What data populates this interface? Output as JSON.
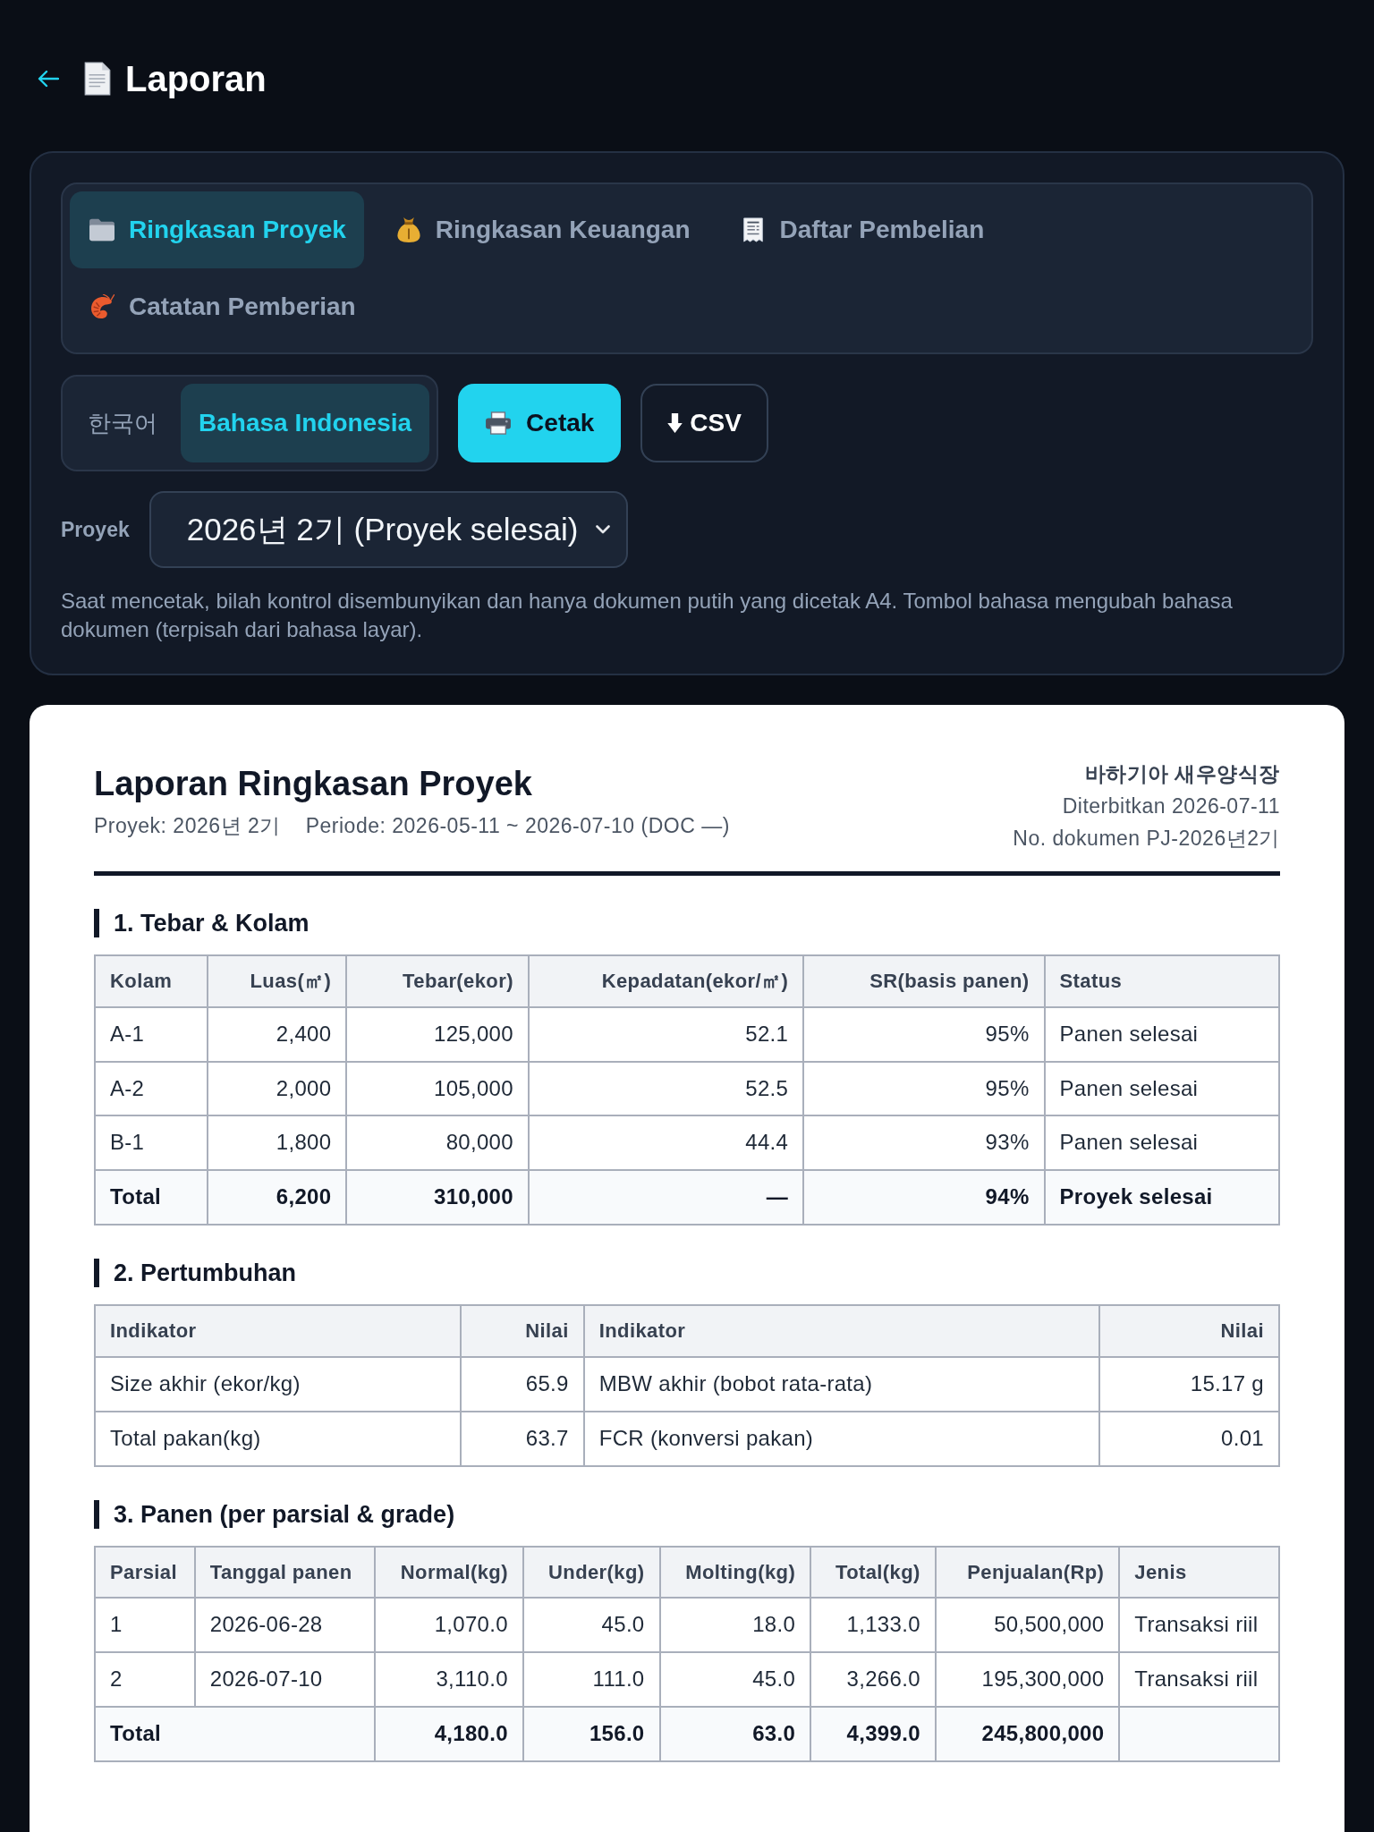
{
  "header": {
    "title": "Laporan"
  },
  "report_tabs": [
    {
      "label": "Ringkasan Proyek",
      "selected": true
    },
    {
      "label": "Ringkasan Keuangan",
      "selected": false
    },
    {
      "label": "Daftar Pembelian",
      "selected": false
    },
    {
      "label": "Catatan Pemberian",
      "selected": false
    }
  ],
  "language_toggle": [
    {
      "label": "한국어",
      "selected": false
    },
    {
      "label": "Bahasa Indonesia",
      "selected": true
    }
  ],
  "actions": [
    {
      "label": "Cetak",
      "kind": "print"
    },
    {
      "label": "CSV",
      "kind": "download"
    }
  ],
  "project_select": {
    "label": "Proyek",
    "value": "2026년 2기 (Proyek selesai)"
  },
  "print_note": "Saat mencetak, bilah kontrol disembunyikan dan hanya dokumen putih yang dicetak A4. Tombol bahasa mengubah bahasa dokumen (terpisah dari bahasa layar).",
  "document": {
    "title": "Laporan Ringkasan Proyek",
    "meta": [
      "Proyek: 2026년 2기",
      "Periode: 2026-05-11 ~ 2026-07-10 (DOC —)"
    ],
    "company": "바하기아 새우양식장",
    "issued": "Diterbitkan 2026-07-11",
    "doc_number": "No. dokumen PJ-2026년2기",
    "sections": [
      {
        "heading": "1. Tebar & Kolam",
        "columns": [
          {
            "label": "Kolam",
            "kind": "text"
          },
          {
            "label": "Luas(㎡)",
            "kind": "number"
          },
          {
            "label": "Tebar(ekor)",
            "kind": "number"
          },
          {
            "label": "Kepadatan(ekor/㎡)",
            "kind": "number"
          },
          {
            "label": "SR(basis panen)",
            "kind": "number"
          },
          {
            "label": "Status",
            "kind": "text"
          }
        ],
        "rows": [
          {
            "kind": "data",
            "cells": [
              "A-1",
              "2,400",
              "125,000",
              "52.1",
              "95%",
              "Panen selesai"
            ]
          },
          {
            "kind": "data",
            "cells": [
              "A-2",
              "2,000",
              "105,000",
              "52.5",
              "95%",
              "Panen selesai"
            ]
          },
          {
            "kind": "data",
            "cells": [
              "B-1",
              "1,800",
              "80,000",
              "44.4",
              "93%",
              "Panen selesai"
            ]
          },
          {
            "kind": "total",
            "cells": [
              "Total",
              "6,200",
              "310,000",
              "—",
              "94%",
              "Proyek selesai"
            ]
          }
        ]
      },
      {
        "heading": "2. Pertumbuhan",
        "columns": [
          {
            "label": "Indikator",
            "kind": "text"
          },
          {
            "label": "Nilai",
            "kind": "number"
          },
          {
            "label": "Indikator",
            "kind": "text"
          },
          {
            "label": "Nilai",
            "kind": "number"
          }
        ],
        "rows": [
          {
            "kind": "data",
            "cells": [
              "Size akhir (ekor/kg)",
              "65.9",
              "MBW akhir (bobot rata-rata)",
              "15.17 g"
            ]
          },
          {
            "kind": "data",
            "cells": [
              "Total pakan(kg)",
              "63.7",
              "FCR (konversi pakan)",
              "0.01"
            ]
          }
        ]
      },
      {
        "heading": "3. Panen (per parsial & grade)",
        "columns": [
          {
            "label": "Parsial",
            "kind": "text"
          },
          {
            "label": "Tanggal panen",
            "kind": "text"
          },
          {
            "label": "Normal(kg)",
            "kind": "number"
          },
          {
            "label": "Under(kg)",
            "kind": "number"
          },
          {
            "label": "Molting(kg)",
            "kind": "number"
          },
          {
            "label": "Total(kg)",
            "kind": "number"
          },
          {
            "label": "Penjualan(Rp)",
            "kind": "number"
          },
          {
            "label": "Jenis",
            "kind": "text"
          }
        ],
        "rows": [
          {
            "kind": "data",
            "cells": [
              "1",
              "2026-06-28",
              "1,070.0",
              "45.0",
              "18.0",
              "1,133.0",
              "50,500,000",
              "Transaksi riil"
            ]
          },
          {
            "kind": "data",
            "cells": [
              "2",
              "2026-07-10",
              "3,110.0",
              "111.0",
              "45.0",
              "3,266.0",
              "195,300,000",
              "Transaksi riil"
            ]
          },
          {
            "kind": "total",
            "cells": [
              {
                "text": "Total",
                "colspan": 2
              },
              "4,180.0",
              "156.0",
              "63.0",
              "4,399.0",
              "245,800,000",
              null
            ]
          }
        ]
      }
    ]
  }
}
